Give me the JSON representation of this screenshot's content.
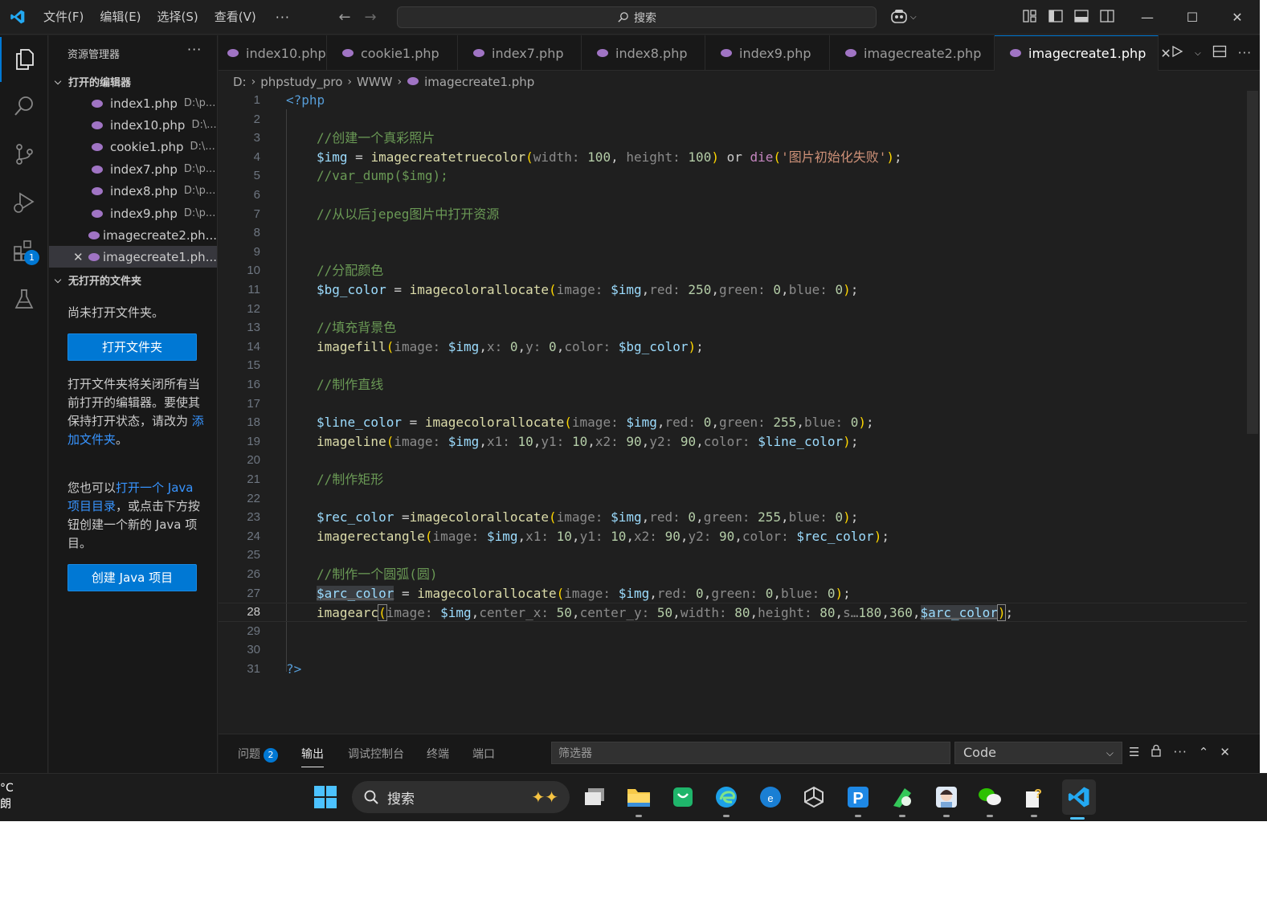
{
  "menu": {
    "items": [
      "文件(F)",
      "编辑(E)",
      "选择(S)",
      "查看(V)"
    ],
    "more": "···"
  },
  "command_center": {
    "label": "搜索"
  },
  "sidebar": {
    "title": "资源管理器",
    "more": "···",
    "open_editors_label": "打开的编辑器",
    "open_editors": [
      {
        "name": "index1.php",
        "path": "D:\\p..."
      },
      {
        "name": "index10.php",
        "path": "D:\\..."
      },
      {
        "name": "cookie1.php",
        "path": "D:\\..."
      },
      {
        "name": "index7.php",
        "path": "D:\\p..."
      },
      {
        "name": "index8.php",
        "path": "D:\\p..."
      },
      {
        "name": "index9.php",
        "path": "D:\\p..."
      },
      {
        "name": "imagecreate2.ph...",
        "path": ""
      },
      {
        "name": "imagecreate1.ph...",
        "path": ""
      }
    ],
    "no_folder_label": "无打开的文件夹",
    "no_folder_text": "尚未打开文件夹。",
    "open_folder_button": "打开文件夹",
    "info1_a": "打开文件夹将关闭所有当前打开的编辑器。要使其保持打开状态，请改为 ",
    "info1_link": "添加文件夹",
    "info1_b": "。",
    "info2_a": "您也可以",
    "info2_link": "打开一个 Java 项目目录",
    "info2_b": "，或点击下方按钮创建一个新的 Java 项目。",
    "create_java_button": "创建 Java 项目"
  },
  "activity_badge": "1",
  "tabs": [
    {
      "label": "index10.php",
      "active": false
    },
    {
      "label": "cookie1.php",
      "active": false
    },
    {
      "label": "index7.php",
      "active": false
    },
    {
      "label": "index8.php",
      "active": false
    },
    {
      "label": "index9.php",
      "active": false
    },
    {
      "label": "imagecreate2.php",
      "active": false
    },
    {
      "label": "imagecreate1.php",
      "active": true
    }
  ],
  "breadcrumb": [
    "D:",
    "phpstudy_pro",
    "WWW",
    "imagecreate1.php"
  ],
  "editor": {
    "current_line": 28,
    "line_numbers": [
      "1",
      "2",
      "3",
      "4",
      "5",
      "6",
      "7",
      "8",
      "9",
      "10",
      "11",
      "12",
      "13",
      "14",
      "15",
      "16",
      "17",
      "18",
      "19",
      "20",
      "21",
      "22",
      "23",
      "24",
      "25",
      "26",
      "27",
      "28",
      "29",
      "30",
      "31"
    ],
    "code": {
      "l1": "<?php",
      "l3": "//创建一个真彩照片",
      "l4_var": "$img",
      "l4_fn": "imagecreatetruecolor",
      "l4_h1": "width:",
      "l4_n1": "100",
      "l4_h2": "height:",
      "l4_n2": "100",
      "l4_or": "or",
      "l4_die": "die",
      "l4_str": "'图片初始化失败'",
      "l5": "//var_dump($img);",
      "l7": "//从以后jepeg图片中打开资源",
      "l10": "//分配颜色",
      "l11_var": "$bg_color",
      "l11_fn": "imagecolorallocate",
      "l11_h1": "image:",
      "l11_v1": "$img",
      "l11_h2": "red:",
      "l11_n2": "250",
      "l11_h3": "green:",
      "l11_n3": "0",
      "l11_h4": "blue:",
      "l11_n4": "0",
      "l13": "//填充背景色",
      "l14_fn": "imagefill",
      "l14_h1": "image:",
      "l14_v1": "$img",
      "l14_h2": "x:",
      "l14_n2": "0",
      "l14_h3": "y:",
      "l14_n3": "0",
      "l14_h4": "color:",
      "l14_v4": "$bg_color",
      "l16": "//制作直线",
      "l18_var": "$line_color",
      "l18_fn": "imagecolorallocate",
      "l18_h1": "image:",
      "l18_v1": "$img",
      "l18_h2": "red:",
      "l18_n2": "0",
      "l18_h3": "green:",
      "l18_n3": "255",
      "l18_h4": "blue:",
      "l18_n4": "0",
      "l19_fn": "imageline",
      "l19_h1": "image:",
      "l19_v1": "$img",
      "l19_h2": "x1:",
      "l19_n2": "10",
      "l19_h3": "y1:",
      "l19_n3": "10",
      "l19_h4": "x2:",
      "l19_n4": "90",
      "l19_h5": "y2:",
      "l19_n5": "90",
      "l19_h6": "color:",
      "l19_v6": "$line_color",
      "l21": "//制作矩形",
      "l23_var": "$rec_color",
      "l23_fn": "imagecolorallocate",
      "l23_h1": "image:",
      "l23_v1": "$img",
      "l23_h2": "red:",
      "l23_n2": "0",
      "l23_h3": "green:",
      "l23_n3": "255",
      "l23_h4": "blue:",
      "l23_n4": "0",
      "l24_fn": "imagerectangle",
      "l24_h1": "image:",
      "l24_v1": "$img",
      "l24_h2": "x1:",
      "l24_n2": "10",
      "l24_h3": "y1:",
      "l24_n3": "10",
      "l24_h4": "x2:",
      "l24_n4": "90",
      "l24_h5": "y2:",
      "l24_n5": "90",
      "l24_h6": "color:",
      "l24_v6": "$rec_color",
      "l26": "//制作一个圆弧(圆)",
      "l27_var": "$arc_color",
      "l27_fn": "imagecolorallocate",
      "l27_h1": "image:",
      "l27_v1": "$img",
      "l27_h2": "red:",
      "l27_n2": "0",
      "l27_h3": "green:",
      "l27_n3": "0",
      "l27_h4": "blue:",
      "l27_n4": "0",
      "l28_fn": "imagearc",
      "l28_h1": "image:",
      "l28_v1": "$img",
      "l28_h2": "center_x:",
      "l28_n2": "50",
      "l28_h3": "center_y:",
      "l28_n3": "50",
      "l28_h4": "width:",
      "l28_n4": "80",
      "l28_h5": "height:",
      "l28_n5": "80",
      "l28_h6": "s…",
      "l28_n6": "180",
      "l28_n7": "360",
      "l28_v8": "$arc_color",
      "l31": "?>"
    }
  },
  "panel": {
    "tabs": [
      "问题",
      "输出",
      "调试控制台",
      "终端",
      "端口"
    ],
    "problems_count": "2",
    "filter_placeholder": "筛选器",
    "output_channel": "Code"
  },
  "taskbar": {
    "weather_temp": "°C",
    "weather_desc": "朗",
    "search_label": "搜索"
  },
  "colors": {
    "accent": "#0078d4",
    "link": "#3794ff",
    "comment": "#6a9955",
    "variable": "#9cdcfe",
    "function": "#dcdcaa",
    "number": "#b5cea8",
    "string": "#ce9178"
  }
}
